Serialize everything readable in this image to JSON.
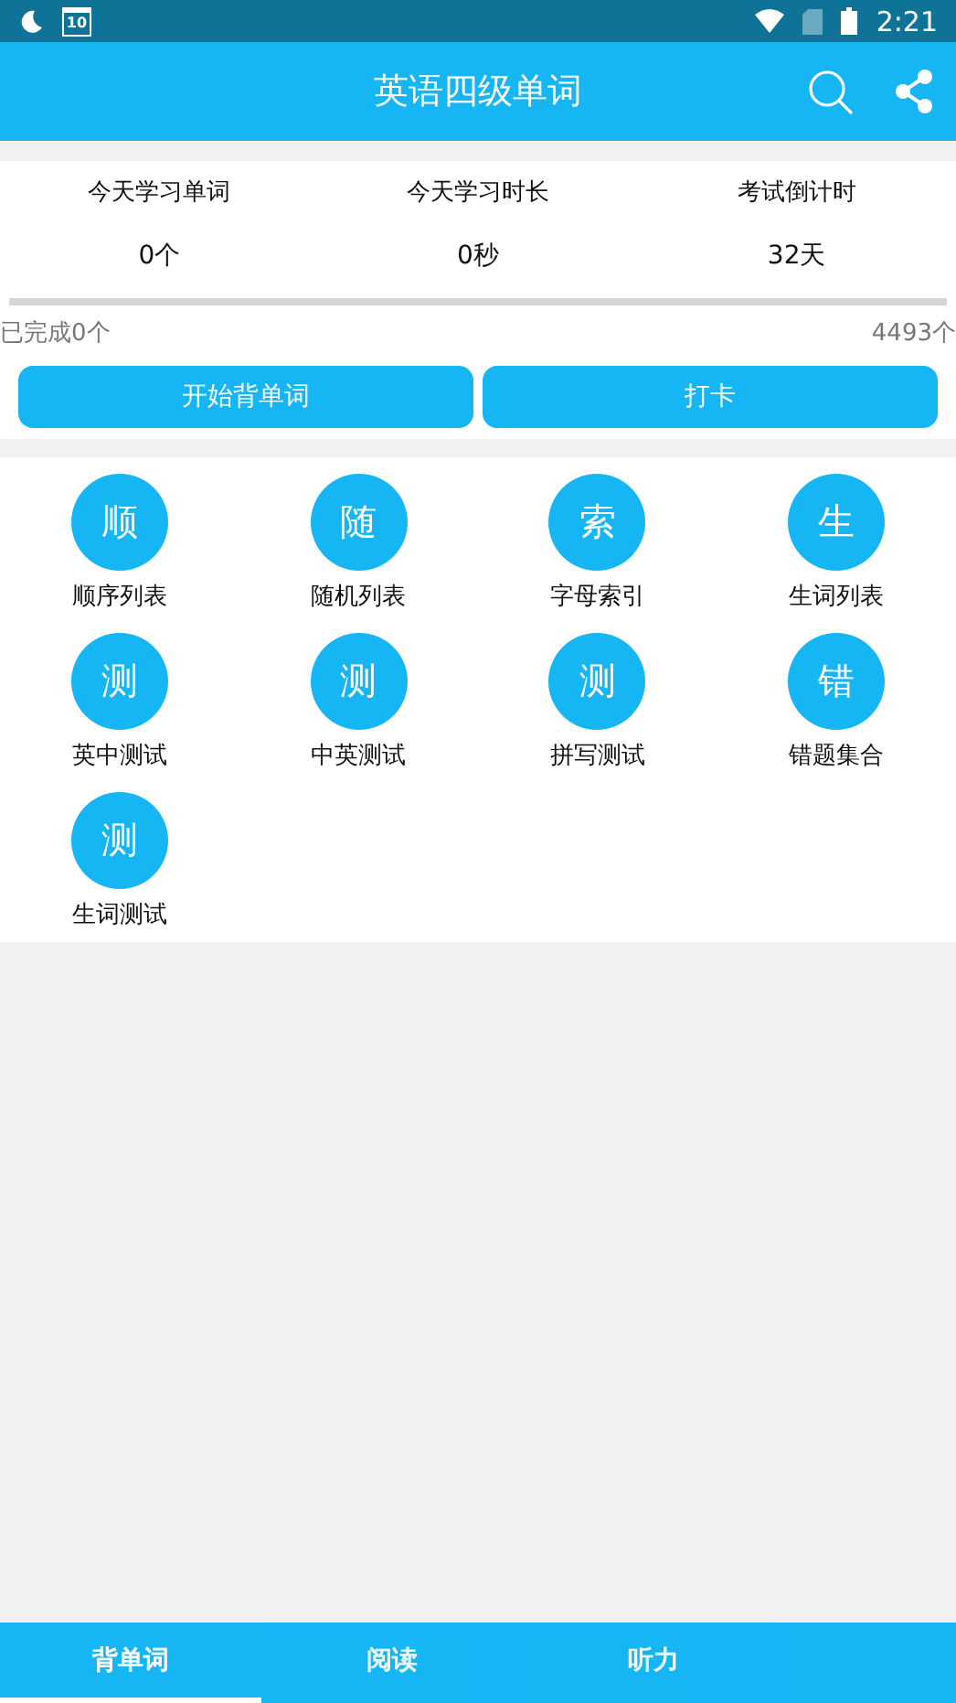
{
  "status_bar": {
    "time": "2:21",
    "calendar_day": "10"
  },
  "app_bar": {
    "title": "英语四级单词"
  },
  "stats": [
    {
      "label": "今天学习单词",
      "value": "0个"
    },
    {
      "label": "今天学习时长",
      "value": "0秒"
    },
    {
      "label": "考试倒计时",
      "value": "32天"
    }
  ],
  "progress": {
    "level": 0,
    "done_label": "已完成0个",
    "total_label": "4493个"
  },
  "buttons": [
    "开始背单词",
    "打卡"
  ],
  "features": [
    {
      "glyph": "顺",
      "label": "顺序列表"
    },
    {
      "glyph": "随",
      "label": "随机列表"
    },
    {
      "glyph": "索",
      "label": "字母索引"
    },
    {
      "glyph": "生",
      "label": "生词列表"
    },
    {
      "glyph": "测",
      "label": "英中测试"
    },
    {
      "glyph": "测",
      "label": "中英测试"
    },
    {
      "glyph": "测",
      "label": "拼写测试"
    },
    {
      "glyph": "错",
      "label": "错题集合"
    },
    {
      "glyph": "测",
      "label": "生词测试"
    }
  ],
  "bottom_tabs": [
    {
      "label": "背单词",
      "selected": true
    },
    {
      "label": "阅读",
      "selected": false
    },
    {
      "label": "听力",
      "selected": false
    }
  ]
}
